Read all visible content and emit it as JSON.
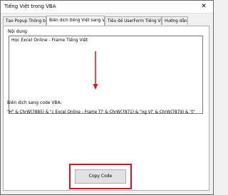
{
  "window": {
    "title": "Tiếng Việt trong VBA",
    "close_glyph": "✕"
  },
  "tabs": [
    {
      "label": "Tạo Popup Thông báo",
      "active": false
    },
    {
      "label": "Biên dịch tiếng Việt sang VBA",
      "active": true
    },
    {
      "label": "Tiêu đề UserForm Tiếng Việt",
      "active": false
    },
    {
      "label": "Hướng dẫn",
      "active": false
    }
  ],
  "panel": {
    "content_label": "Nội dung",
    "content_value": "Học Excel Online - Frame Tiếng Việt",
    "output_label": "Biên dịch sang code VBA:",
    "output_value": "\"H\" & ChrW(7885) & \"c Excel Online - Frame Ti\" & ChrW(7871) & \"ng Vi\" & ChrW(7879) & \"t\"",
    "copy_button_label": "Copy Code"
  },
  "colors": {
    "annotation": "#d9141a",
    "window_bg": "#f0f0f0"
  },
  "icons": {
    "close": "close-icon",
    "annotation_arrow": "arrow-down-icon"
  }
}
